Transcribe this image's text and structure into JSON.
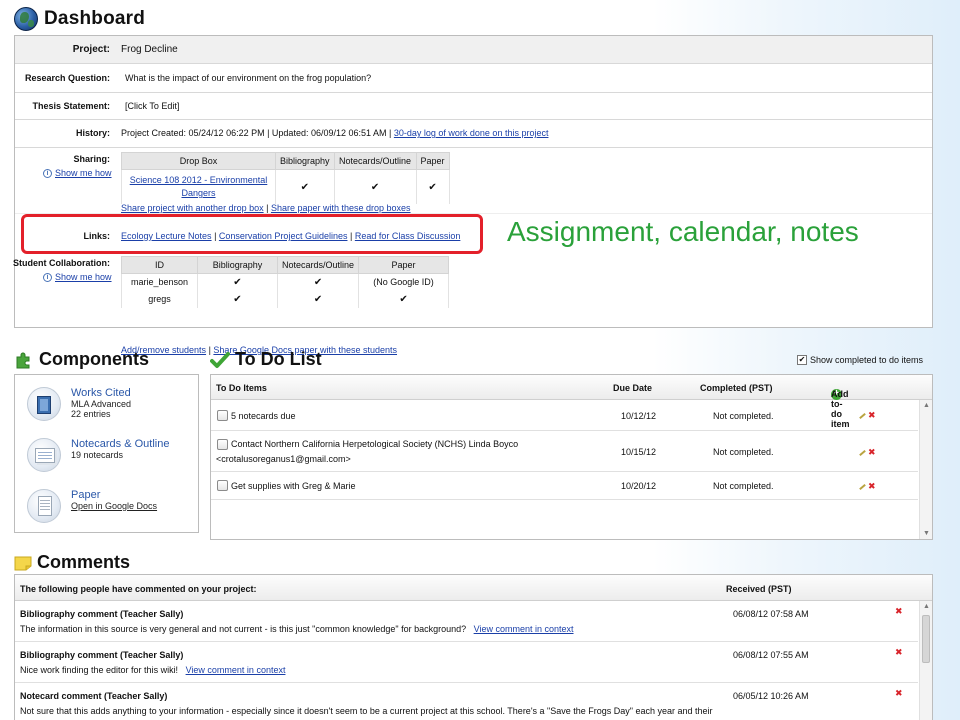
{
  "header": {
    "title": "Dashboard"
  },
  "project": {
    "project_label": "Project:",
    "project_value": "Frog Decline",
    "rq_label": "Research Question:",
    "rq_value": "What is the impact of our environment on the frog population?",
    "thesis_label": "Thesis Statement:",
    "thesis_value": "[Click To Edit]",
    "history_label": "History:",
    "history_text": "Project Created: 05/24/12 06:22 PM | Updated: 06/09/12 06:51 AM |",
    "history_link": "30-day log of work done on this project",
    "sharing_label": "Sharing:",
    "show_me_how": "Show me how",
    "sharing_table": {
      "headers": [
        "Drop Box",
        "Bibliography",
        "Notecards/Outline",
        "Paper"
      ],
      "row_link": "Science 108 2012 - Environmental Dangers",
      "checks": [
        "✔",
        "✔",
        "✔"
      ]
    },
    "share_project_link": "Share project with another drop box",
    "share_paper_link": "Share paper with these drop boxes",
    "links_label": "Links:",
    "links": [
      "Ecology Lecture Notes",
      "Conservation Project Guidelines",
      "Read for Class Discussion"
    ],
    "collab_label": "Student Collaboration:",
    "collab_table": {
      "headers": [
        "ID",
        "Bibliography",
        "Notecards/Outline",
        "Paper"
      ],
      "rows": [
        {
          "id": "marie_benson",
          "bib": "✔",
          "notes": "✔",
          "paper": "(No Google ID)"
        },
        {
          "id": "gregs",
          "bib": "✔",
          "notes": "✔",
          "paper": "✔"
        }
      ]
    },
    "add_remove_link": "Add/remove students",
    "share_google_link": "Share Google Docs paper with these students"
  },
  "annotation": "Assignment, calendar, notes",
  "components": {
    "title": "Components",
    "items": [
      {
        "title": "Works Cited",
        "sub1": "MLA Advanced",
        "sub2": "22 entries"
      },
      {
        "title": "Notecards & Outline",
        "sub1": "19 notecards"
      },
      {
        "title": "Paper",
        "link": "Open in Google Docs"
      }
    ]
  },
  "todo": {
    "title": "To Do List",
    "show_completed": "Show completed to do items",
    "headers": {
      "items": "To Do Items",
      "due": "Due Date",
      "completed": "Completed (PST)",
      "add": "Add to-do item"
    },
    "rows": [
      {
        "text": "5 notecards due",
        "text2": "",
        "due": "10/12/12",
        "status": "Not completed."
      },
      {
        "text": "Contact Northern California Herpetological Society (NCHS) Linda Boyco",
        "text2": "<crotalusoreganus1@gmail.com>",
        "due": "10/15/12",
        "status": "Not completed."
      },
      {
        "text": "Get supplies with Greg & Marie",
        "text2": "",
        "due": "10/20/12",
        "status": "Not completed."
      }
    ]
  },
  "comments": {
    "title": "Comments",
    "header_left": "The following people have commented on your project:",
    "header_right": "Received (PST)",
    "rows": [
      {
        "title": "Bibliography comment (Teacher Sally)",
        "text": "The information in this source is very general and not current - is this just \"common knowledge\" for background?",
        "link": "View comment in context",
        "date": "06/08/12 07:58 AM"
      },
      {
        "title": "Bibliography comment (Teacher Sally)",
        "text": "Nice work finding the editor for this wiki!",
        "link": "View comment in context",
        "date": "06/08/12 07:55 AM"
      },
      {
        "title": "Notecard comment (Teacher Sally)",
        "text": "Not sure that this adds anything to your information - especially since it doesn't seem to be a current project at this school. There's a \"Save the Frogs Day\" each year and their",
        "link": "",
        "date": "06/05/12 10:26 AM"
      }
    ]
  }
}
